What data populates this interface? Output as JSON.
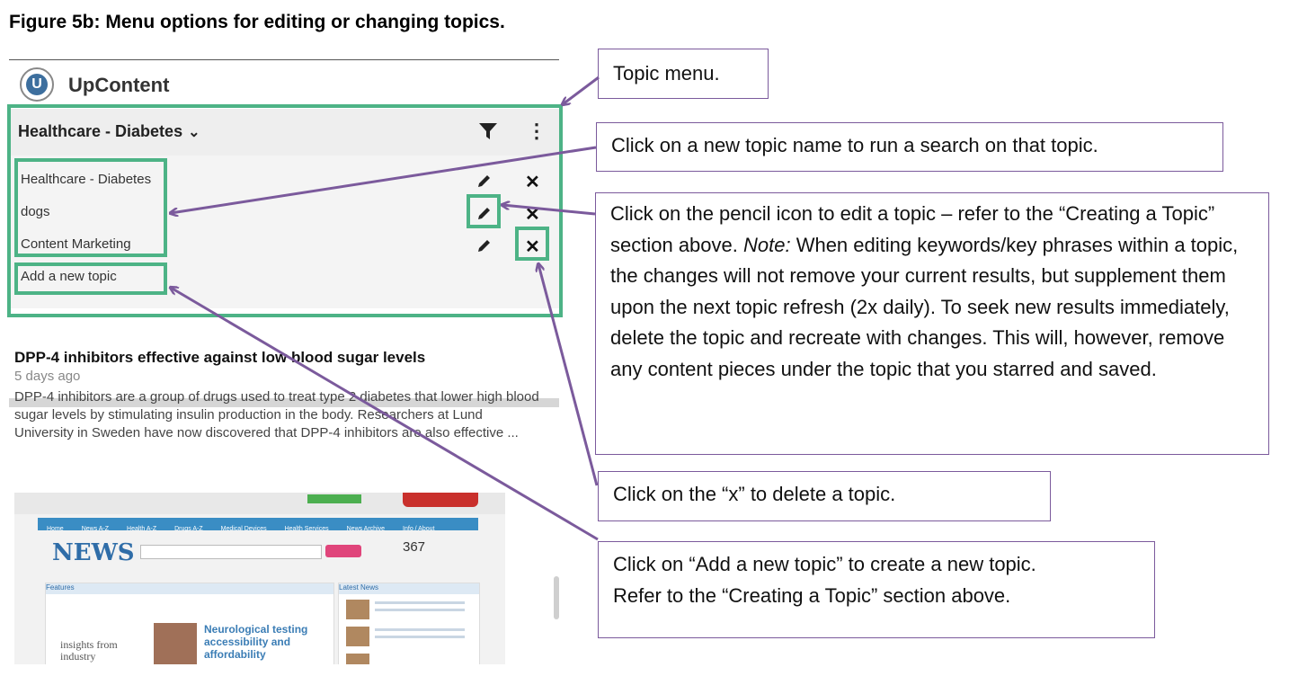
{
  "figure_title": "Figure 5b: Menu options for editing or changing topics.",
  "app": {
    "logo_letter": "U",
    "brand": "UpContent",
    "current_topic": "Healthcare - Diabetes",
    "topics": [
      "Healthcare - Diabetes",
      "dogs",
      "Content Marketing"
    ],
    "add_topic": "Add a new topic",
    "icons": {
      "filter": "filter-icon",
      "more": "more-vertical-icon",
      "edit": "pencil-icon",
      "delete": "close-icon"
    }
  },
  "article": {
    "title": "DPP-4 inhibitors effective against low blood sugar levels",
    "age": "5 days ago",
    "body": "DPP-4 inhibitors are a group of drugs used to treat type 2 diabetes that lower high blood sugar levels by stimulating insulin production in the body. Researchers at Lund University in Sweden have now discovered that DPP-4 inhibitors are also effective ..."
  },
  "news_image": {
    "nav": [
      "Home",
      "News A-Z",
      "Health A-Z",
      "Drugs A-Z",
      "Medical Devices",
      "Health Services",
      "News Archive",
      "Info / About"
    ],
    "logo": "NEWS",
    "count": "367",
    "features": "Features",
    "latest": "Latest News",
    "insights": "insights from industry",
    "headline": "Neurological testing accessibility and affordability"
  },
  "callouts": {
    "topic_menu": "Topic menu.",
    "click_topic": "Click on a new topic name to run a search on that topic.",
    "pencil_lead": "Click on the pencil icon to edit a topic – refer to the “Creating a Topic” section above. ",
    "pencil_note_label": "Note:",
    "pencil_rest": " When editing keywords/key phrases within a topic, the changes will not remove your current results, but supplement them upon the next topic refresh (2x daily).  To seek new results immediately, delete the topic and recreate with changes.  This will, however, remove any content pieces under the topic that you starred and saved.",
    "delete": "Click on the “x” to delete a topic.",
    "add_line1": "Click on “Add a new topic” to create a new topic.",
    "add_line2": "Refer to the “Creating a Topic” section above."
  },
  "colors": {
    "highlight": "#4db386",
    "arrow": "#7b5a9c",
    "brand_blue": "#3d6f9e"
  }
}
